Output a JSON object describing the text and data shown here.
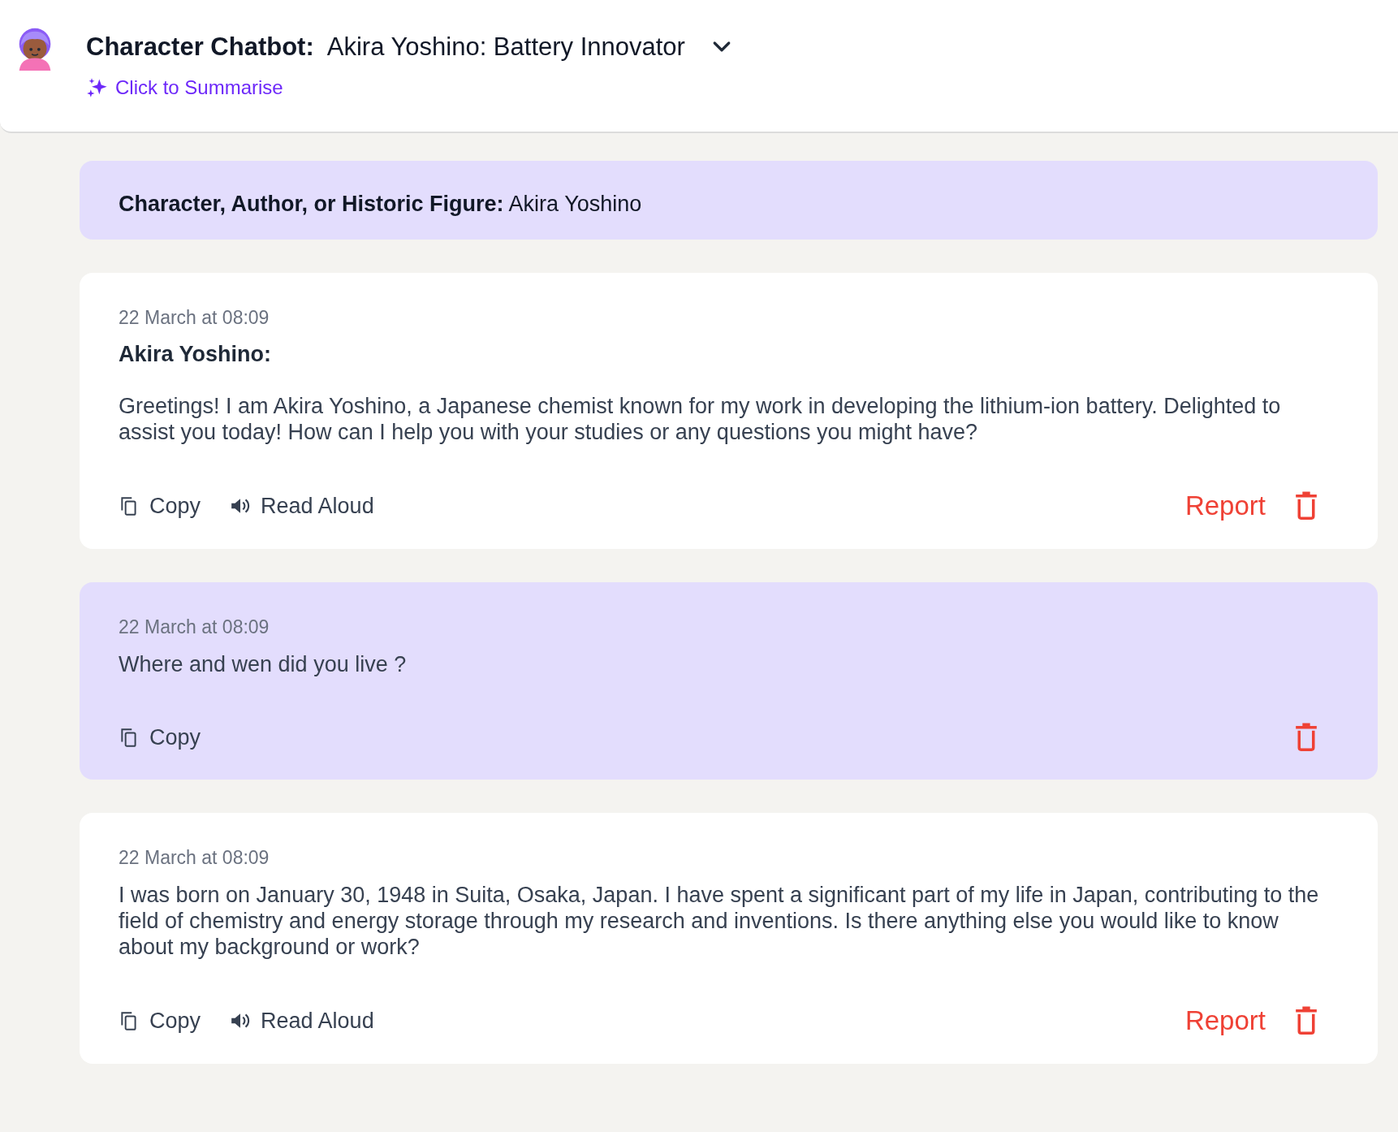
{
  "header": {
    "label": "Character Chatbot:",
    "title": "Akira Yoshino: Battery Innovator",
    "summarise": "Click to Summarise"
  },
  "intro": {
    "label": "Character, Author, or Historic Figure:",
    "value": "Akira Yoshino"
  },
  "messages": [
    {
      "kind": "assistant",
      "time": "22 March at 08:09",
      "author": "Akira Yoshino:",
      "text": "Greetings! I am Akira Yoshino, a Japanese chemist known for my work in developing the lithium-ion battery. Delighted to assist you today! How can I help you with your studies or any questions you might have?",
      "copy": "Copy",
      "read_aloud": "Read Aloud",
      "report": "Report"
    },
    {
      "kind": "user",
      "time": "22 March at 08:09",
      "text": "Where and wen did you live ?",
      "copy": "Copy"
    },
    {
      "kind": "assistant",
      "time": "22 March at 08:09",
      "text": "I was born on January 30, 1948 in Suita, Osaka, Japan. I have spent a significant part of my life in Japan, contributing to the field of chemistry and energy storage through my research and inventions. Is there anything else you would like to know about my background or work?",
      "copy": "Copy",
      "read_aloud": "Read Aloud",
      "report": "Report"
    }
  ]
}
